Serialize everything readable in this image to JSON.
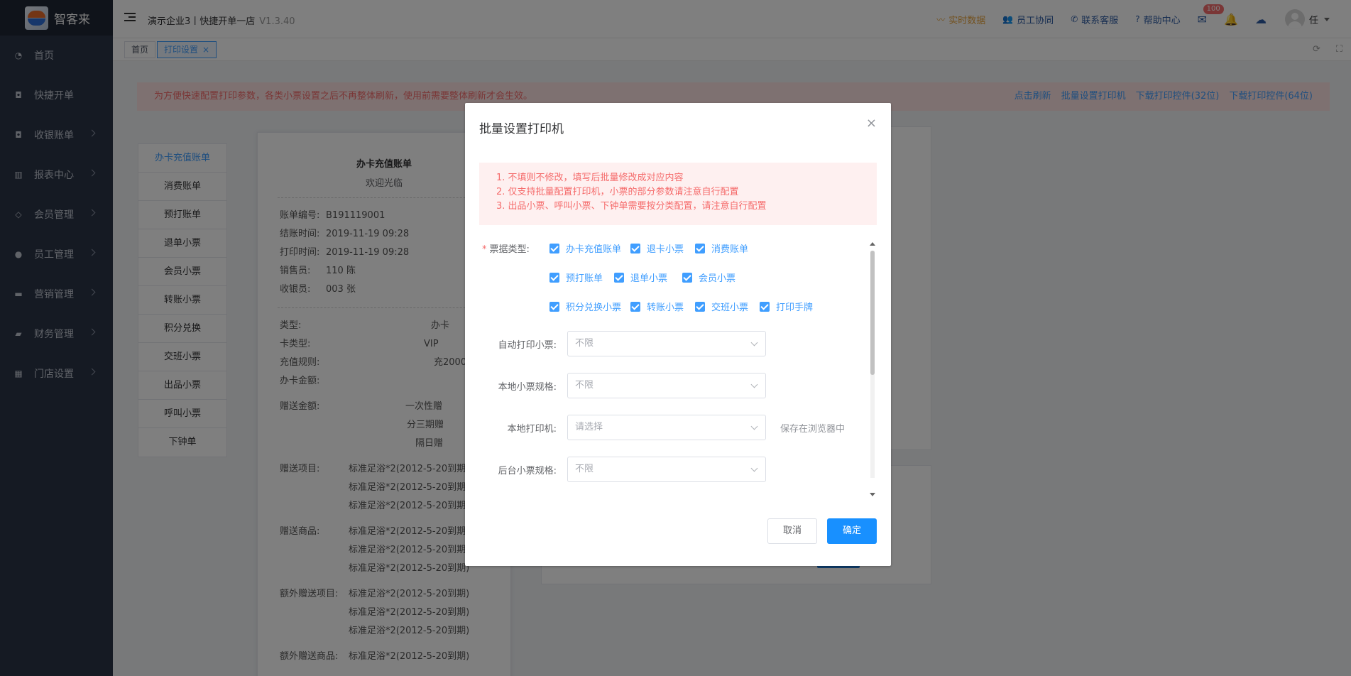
{
  "app": {
    "name": "智客来"
  },
  "sidebar": {
    "items": [
      {
        "label": "首页",
        "icon": "dashboard-icon",
        "has_children": false
      },
      {
        "label": "快捷开单",
        "icon": "bag-icon",
        "has_children": false
      },
      {
        "label": "收银账单",
        "icon": "bag-icon",
        "has_children": true
      },
      {
        "label": "报表中心",
        "icon": "bar-chart-icon",
        "has_children": true
      },
      {
        "label": "会员管理",
        "icon": "diamond-icon",
        "has_children": true
      },
      {
        "label": "员工管理",
        "icon": "person-icon",
        "has_children": true
      },
      {
        "label": "营销管理",
        "icon": "briefcase-icon",
        "has_children": true
      },
      {
        "label": "财务管理",
        "icon": "wallet-icon",
        "has_children": true
      },
      {
        "label": "门店设置",
        "icon": "grid-icon",
        "has_children": true
      }
    ]
  },
  "header": {
    "company": "演示企业3丨快捷开单一店",
    "version": "V1.3.40",
    "links": [
      {
        "label": "实时数据",
        "icon": "realtime-icon"
      },
      {
        "label": "员工协同",
        "icon": "users-icon"
      },
      {
        "label": "联系客服",
        "icon": "phone-icon"
      },
      {
        "label": "帮助中心",
        "icon": "help-icon"
      }
    ],
    "mail_badge": "100",
    "user_name": "任"
  },
  "tabs": [
    {
      "label": "首页",
      "active": false
    },
    {
      "label": "打印设置",
      "active": true,
      "close": "×"
    }
  ],
  "page": {
    "alert": "为方便快速配置打印参数，各类小票设置之后不再整体刷新，使用前需要整体刷新才会生效。",
    "alert_actions": [
      "点击刷新",
      "批量设置打印机",
      "下载打印控件(32位)",
      "下载打印控件(64位)"
    ],
    "subnav": [
      "办卡充值账单",
      "消费账单",
      "预打账单",
      "退单小票",
      "会员小票",
      "转账小票",
      "积分兑换",
      "交班小票",
      "出品小票",
      "呼叫小票",
      "下钟单"
    ],
    "receipt": {
      "title": "办卡充值账单",
      "subtitle": "欢迎光临",
      "info": [
        {
          "k": "账单编号:",
          "v": "B191119001"
        },
        {
          "k": "结账时间:",
          "v": "2019-11-19 09:28"
        },
        {
          "k": "打印时间:",
          "v": "2019-11-19 09:28"
        },
        {
          "k": "销售员:",
          "v": "110 陈"
        },
        {
          "k": "收银员:",
          "v": "003 张"
        }
      ],
      "card": [
        {
          "k": "类型:",
          "v": "办卡"
        },
        {
          "k": "卡类型:",
          "v": "VIP"
        },
        {
          "k": "充值规则:",
          "v": "充2000"
        },
        {
          "k": "办卡金额:",
          "v": ""
        }
      ],
      "gift_label": "赠送金额:",
      "gift_lines": [
        "一次性赠",
        "分三期赠",
        "隔日赠"
      ],
      "gift_items_label": "赠送项目:",
      "gift_goods_label": "赠送商品:",
      "extra_items_label": "额外赠送项目:",
      "extra_goods_label": "额外赠送商品:",
      "item_line": "标准足浴*2(2012-5-20到期)"
    }
  },
  "dialog": {
    "title": "批量设置打印机",
    "close": "×",
    "notices": [
      "1. 不填则不修改，填写后批量修改成对应内容",
      "2. 仅支持批量配置打印机，小票的部分参数请注意自行配置",
      "3. 出品小票、呼叫小票、下钟单需要按分类配置，请注意自行配置"
    ],
    "type_label": "票据类型:",
    "required_mark": "*",
    "checkboxes": [
      [
        "办卡充值账单",
        "退卡小票",
        "消费账单"
      ],
      [
        "预打账单",
        "退单小票",
        "会员小票"
      ],
      [
        "积分兑换小票",
        "转账小票",
        "交班小票",
        "打印手牌"
      ]
    ],
    "fields": [
      {
        "label": "自动打印小票:",
        "placeholder": "不限",
        "hint": ""
      },
      {
        "label": "本地小票规格:",
        "placeholder": "不限",
        "hint": ""
      },
      {
        "label": "本地打印机:",
        "placeholder": "请选择",
        "hint": "保存在浏览器中"
      },
      {
        "label": "后台小票规格:",
        "placeholder": "不限",
        "hint": ""
      }
    ],
    "cancel": "取消",
    "confirm": "确定"
  }
}
